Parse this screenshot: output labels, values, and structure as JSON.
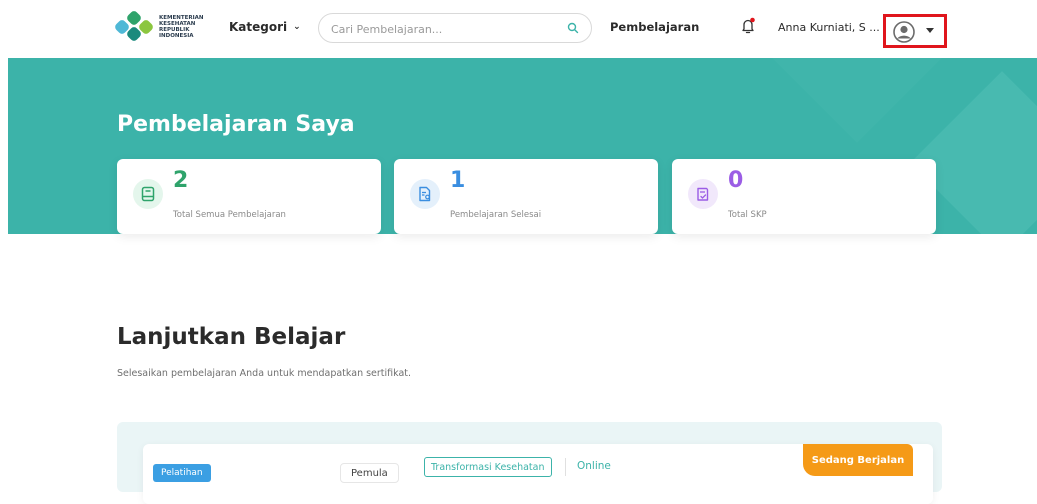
{
  "header": {
    "logo_text": "KEMENTERIAN KESEHATAN REPUBLIK INDONESIA",
    "kategori_label": "Kategori",
    "search_placeholder": "Cari Pembelajaran...",
    "nav_link": "Pembelajaran",
    "user_name": "Anna Kurniati, S ..."
  },
  "hero": {
    "title": "Pembelajaran Saya",
    "stats": [
      {
        "value": "2",
        "label": "Total Semua Pembelajaran",
        "icon": "book-icon",
        "color": "#2fa36b",
        "bg": "#e4f6ec"
      },
      {
        "value": "1",
        "label": "Pembelajaran Selesai",
        "icon": "document-search-icon",
        "color": "#3a8ee0",
        "bg": "#e4f0fb"
      },
      {
        "value": "0",
        "label": "Total SKP",
        "icon": "certificate-icon",
        "color": "#9b5de5",
        "bg": "#f1e8fb"
      }
    ]
  },
  "continue": {
    "title": "Lanjutkan Belajar",
    "subtitle": "Selesaikan pembelajaran Anda untuk mendapatkan sertifikat.",
    "course": {
      "type_badge": "Pelatihan",
      "level_badge": "Pemula",
      "topic_badge": "Transformasi Kesehatan",
      "mode": "Online",
      "status": "Sedang Berjalan"
    }
  },
  "colors": {
    "primary": "#3cb3a9",
    "highlight": "#e0151c",
    "status": "#f59a17"
  }
}
